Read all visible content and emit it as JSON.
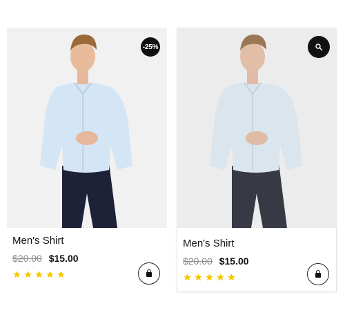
{
  "products": [
    {
      "name": "Men's Shirt",
      "old_price": "$20.00",
      "new_price": "$15.00",
      "badge": "-25%",
      "rating": 5,
      "image": "man-in-light-blue-shirt-and-navy-jeans",
      "colors": {
        "shirt": "#d4e6f6",
        "pants": "#1e2238"
      }
    },
    {
      "name": "Men's Shirt",
      "old_price": "$20.00",
      "new_price": "$15.00",
      "rating": 5,
      "hover_icon": "search-icon",
      "image": "man-in-light-blue-shirt-and-navy-jeans",
      "colors": {
        "shirt": "#d8e4ee",
        "pants": "#1a1d29"
      }
    }
  ],
  "star_color": "#f7c600",
  "cart_icon": "shopping-bag-icon"
}
